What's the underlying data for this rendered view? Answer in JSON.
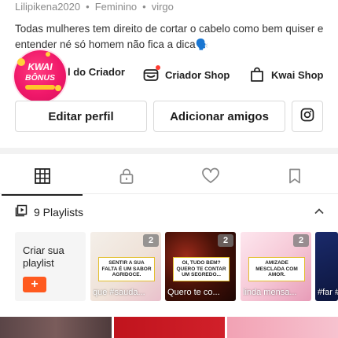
{
  "profile": {
    "username": "Lilipikena2020",
    "gender": "Feminino",
    "sign": "virgo",
    "separator": "•",
    "bio": "Todas mulheres tem direito de cortar o cabelo como bem quiser e entender né só homem não fica a dica🗣️"
  },
  "badge": {
    "line1": "KWAI",
    "line2": "BÔNUS"
  },
  "tools": [
    {
      "label": "Central do Criador",
      "visible_label": "l do Criador",
      "icon": "creator-center-icon"
    },
    {
      "label": "Criador Shop",
      "icon": "creator-shop-icon"
    },
    {
      "label": "Kwai Shop",
      "icon": "shopping-bag-icon"
    }
  ],
  "actions": {
    "edit_profile": "Editar perfil",
    "add_friends": "Adicionar amigos",
    "instagram_icon": "instagram-icon"
  },
  "tabs": [
    {
      "name": "grid",
      "icon": "grid-icon",
      "active": true
    },
    {
      "name": "private",
      "icon": "lock-icon",
      "active": false
    },
    {
      "name": "liked",
      "icon": "heart-icon",
      "active": false
    },
    {
      "name": "saved",
      "icon": "bookmark-icon",
      "active": false
    }
  ],
  "playlists": {
    "header": "9 Playlists",
    "create_label": "Criar sua playlist",
    "create_button": "+",
    "items": [
      {
        "count": "2",
        "quote": "SENTIR A SUA FALTA É UM SABOR AGRIDOCE.",
        "caption": "que #sauda..."
      },
      {
        "count": "2",
        "quote": "OI, TUDO BEM? QUERO TE CONTAR UM SEGREDO...",
        "caption": "Quero te co..."
      },
      {
        "count": "2",
        "quote": "AMIZADE MESCLADA COM AMOR.",
        "caption": "linda mensa..."
      },
      {
        "count": "",
        "quote": "",
        "caption": "#far #PU"
      }
    ]
  },
  "colors": {
    "accent": "#ff5a1f",
    "badge": "#f0186a",
    "notification": "#ff3b30"
  }
}
